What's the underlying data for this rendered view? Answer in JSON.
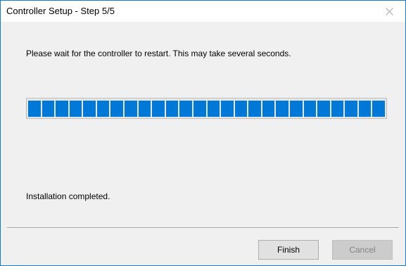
{
  "window": {
    "title": "Controller Setup - Step 5/5",
    "close_icon": "close-icon"
  },
  "content": {
    "message": "Please wait for the controller to restart. This may take several seconds.",
    "progress_percent": 100,
    "progress_block_count": 26,
    "progress_color": "#0078d7",
    "status": "Installation completed."
  },
  "buttons": {
    "finish_label": "Finish",
    "cancel_label": "Cancel",
    "cancel_enabled": false
  }
}
